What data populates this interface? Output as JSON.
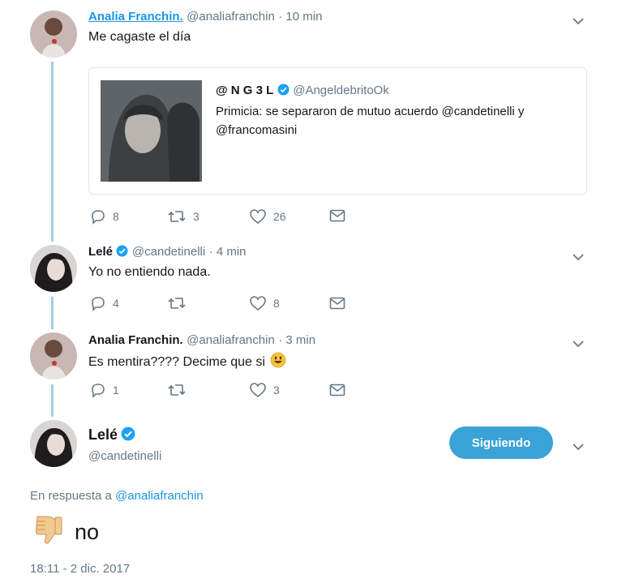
{
  "tweets": [
    {
      "name": "Analia Franchin.",
      "handle": "@analiafranchin",
      "time": "· 10 min",
      "text": "Me cagaste el día",
      "replies": "8",
      "retweets": "3",
      "likes": "26"
    },
    {
      "name": "Lelé",
      "handle": "@candetinelli",
      "time": "· 4 min",
      "text": "Yo no entiendo nada.",
      "replies": "4",
      "retweets": "",
      "likes": "8"
    },
    {
      "name": "Analia Franchin.",
      "handle": "@analiafranchin",
      "time": "· 3 min",
      "text": "Es mentira???? Decime que si",
      "replies": "1",
      "retweets": "",
      "likes": "3"
    }
  ],
  "quoted": {
    "name": "@ N G 3 L",
    "handle": "@AngeldebritoOk",
    "text_line1": "Primicia: se separaron de mutuo acuerdo @candetinelli y",
    "text_line2": "@francomasini"
  },
  "main": {
    "name": "Lelé",
    "handle": "@candetinelli",
    "follow_label": "Siguiendo",
    "reply_prefix": "En respuesta a",
    "reply_to": "@analiafranchin",
    "text": "no",
    "timestamp": "18:11 - 2 dic. 2017"
  },
  "colors": {
    "accent": "#1da1f2",
    "follow_button": "#3aa3d6",
    "thread_line": "#9fd1e6",
    "muted": "#657786"
  },
  "icons": [
    "reply-icon",
    "retweet-icon",
    "heart-icon",
    "dm-icon",
    "chevron-down-icon",
    "verified-icon",
    "emoji-smile-icon",
    "thumbs-down-emoji"
  ]
}
